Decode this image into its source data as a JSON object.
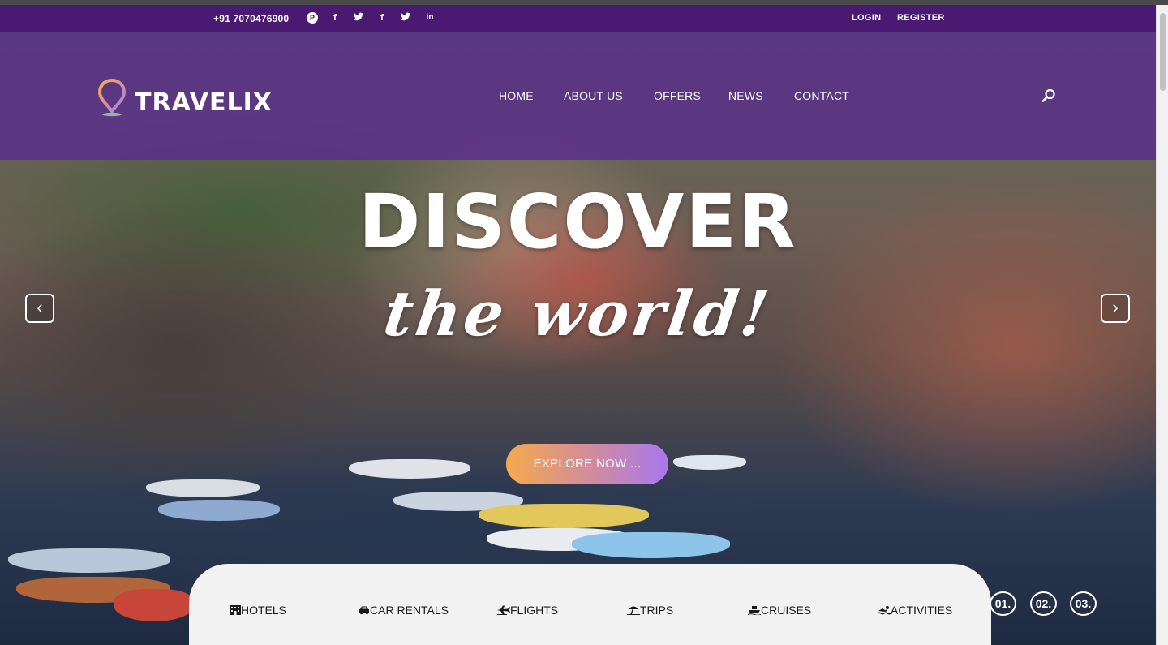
{
  "topbar": {
    "phone": "+91 7070476900",
    "social": [
      "pinterest-icon",
      "facebook-icon",
      "twitter-icon",
      "facebook-icon",
      "twitter-icon",
      "linkedin-icon"
    ],
    "login": "LOGIN",
    "register": "REGISTER"
  },
  "header": {
    "logo": "TRAVELIX",
    "nav": [
      "HOME",
      "ABOUT US",
      "OFFERS",
      "NEWS",
      "CONTACT"
    ]
  },
  "hero": {
    "title": "DISCOVER",
    "subtitle": "the world!",
    "cta": "EXPLORE NOW ...",
    "prev": "‹",
    "next": "›"
  },
  "tabs": [
    "HOTELS",
    "CAR RENTALS",
    "FLIGHTS",
    "TRIPS",
    "CRUISES",
    "ACTIVITIES"
  ],
  "slides": [
    "01.",
    "02.",
    "03."
  ],
  "colors": {
    "topbar": "#4a1a72",
    "header": "#5a2d8c",
    "cta_start": "#f5a94c",
    "cta_end": "#a778f0"
  }
}
